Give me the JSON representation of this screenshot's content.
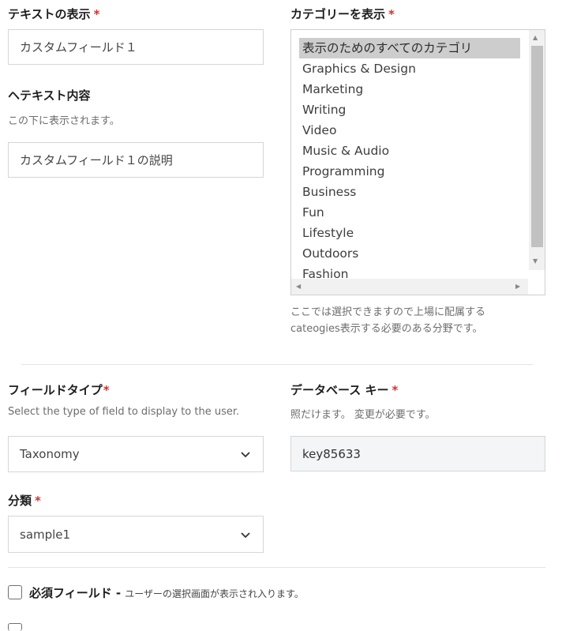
{
  "text_display": {
    "label": "テキストの表示",
    "required_mark": "*",
    "value": "カスタムフィールド１"
  },
  "help_text": {
    "label": "ヘテキスト内容",
    "help": "この下に表示されます。",
    "value": "カスタムフィールド１の説明"
  },
  "category_display": {
    "label": "カテゴリーを表示",
    "required_mark": "*",
    "options": [
      "表示のためのすべてのカテゴリ",
      "Graphics & Design",
      "Marketing",
      "Writing",
      "Video",
      "Music & Audio",
      "Programming",
      "Business",
      "Fun",
      "Lifestyle",
      "Outdoors",
      "Fashion"
    ],
    "selected_index": 0,
    "help_line1": "ここでは選択できますので上場に配属する",
    "help_line2": "cateogies表示する必要のある分野です。"
  },
  "field_type": {
    "label": "フィールドタイプ",
    "required_mark": "*",
    "help": "Select the type of field to display to the user.",
    "value": "Taxonomy"
  },
  "database_key": {
    "label": "データベース キー",
    "required_mark": "*",
    "help": "照だけます。 変更が必要です。",
    "value": "key85633"
  },
  "taxonomy": {
    "label": "分類",
    "required_mark": "*",
    "value": "sample1"
  },
  "required_field": {
    "label": "必須フィールド -",
    "description": "ユーザーの選択画面が表示され入ります。",
    "checked": false
  }
}
